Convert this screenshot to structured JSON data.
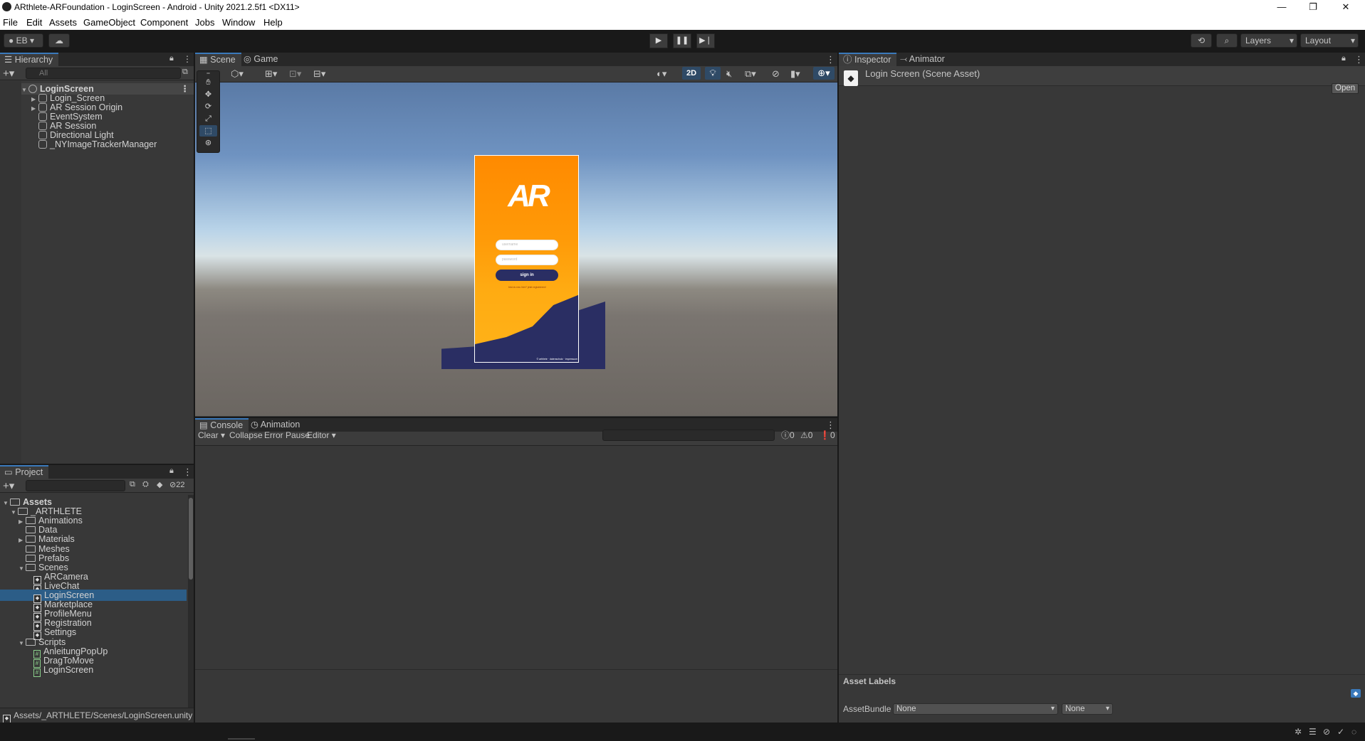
{
  "window": {
    "title": "ARthlete-ARFoundation - LoginScreen - Android - Unity 2021.2.5f1 <DX11>",
    "minimize": "—",
    "maximize": "❐",
    "close": "✕"
  },
  "menu": [
    "File",
    "Edit",
    "Assets",
    "GameObject",
    "Component",
    "Jobs",
    "Window",
    "Help"
  ],
  "toolbar": {
    "account": "EB",
    "layers": "Layers",
    "layout": "Layout"
  },
  "hierarchy": {
    "tab": "Hierarchy",
    "search_placeholder": "All",
    "root": "LoginScreen",
    "items": [
      "Login_Screen",
      "AR Session Origin",
      "EventSystem",
      "AR Session",
      "Directional Light",
      "_NYImageTrackerManager"
    ]
  },
  "scene_tabs": [
    "Scene",
    "Game"
  ],
  "scene_toolbar": {
    "mode_2d": "2D"
  },
  "phone": {
    "logo_text": "AR",
    "username_placeholder": "username",
    "password_placeholder": "password",
    "sign_in": "sign in",
    "register_link": "bist du neu hier? jetzt registrieren!",
    "footer": "© arthlete · datenschutz · impressum"
  },
  "project": {
    "tab": "Project",
    "hidden_count": "22",
    "tree": [
      {
        "label": "Assets",
        "level": 0,
        "type": "folder-open",
        "bold": true
      },
      {
        "label": "_ARTHLETE",
        "level": 1,
        "type": "folder-open"
      },
      {
        "label": "Animations",
        "level": 2,
        "type": "folder",
        "arrow": true
      },
      {
        "label": "Data",
        "level": 2,
        "type": "folder"
      },
      {
        "label": "Materials",
        "level": 2,
        "type": "folder",
        "arrow": true
      },
      {
        "label": "Meshes",
        "level": 2,
        "type": "folder"
      },
      {
        "label": "Prefabs",
        "level": 2,
        "type": "folder"
      },
      {
        "label": "Scenes",
        "level": 2,
        "type": "folder-open"
      },
      {
        "label": "ARCamera",
        "level": 3,
        "type": "scene"
      },
      {
        "label": "LiveChat",
        "level": 3,
        "type": "scene"
      },
      {
        "label": "LoginScreen",
        "level": 3,
        "type": "scene",
        "selected": true
      },
      {
        "label": "Marketplace",
        "level": 3,
        "type": "scene"
      },
      {
        "label": "ProfileMenu",
        "level": 3,
        "type": "scene"
      },
      {
        "label": "Registration",
        "level": 3,
        "type": "scene"
      },
      {
        "label": "Settings",
        "level": 3,
        "type": "scene"
      },
      {
        "label": "Scripts",
        "level": 2,
        "type": "folder-open"
      },
      {
        "label": "AnleitungPopUp",
        "level": 3,
        "type": "script"
      },
      {
        "label": "DragToMove",
        "level": 3,
        "type": "script"
      },
      {
        "label": "LoginScreen",
        "level": 3,
        "type": "script"
      }
    ],
    "path": "Assets/_ARTHLETE/Scenes/LoginScreen.unity"
  },
  "console": {
    "tabs": [
      "Console",
      "Animation"
    ],
    "clear": "Clear",
    "collapse": "Collapse",
    "error_pause": "Error Pause",
    "editor": "Editor",
    "log_count": "0",
    "warn_count": "0",
    "error_count": "0"
  },
  "inspector": {
    "tabs": [
      "Inspector",
      "Animator"
    ],
    "asset_title": "Login Screen (Scene Asset)",
    "open": "Open",
    "asset_labels": "Asset Labels",
    "asset_bundle_label": "AssetBundle",
    "asset_bundle_value": "None",
    "asset_variant_value": "None"
  }
}
